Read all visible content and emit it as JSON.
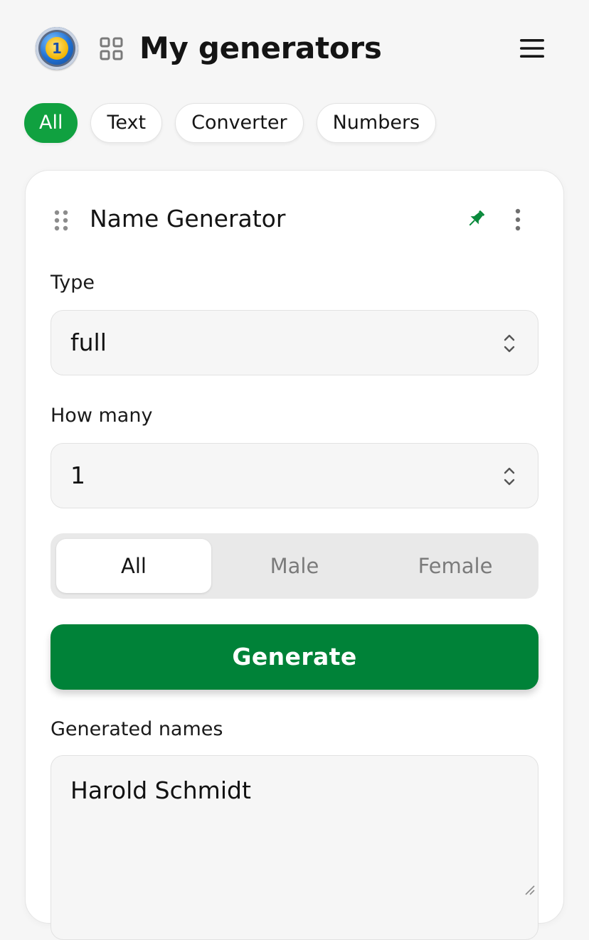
{
  "header": {
    "title": "My generators",
    "logo_text": "1",
    "icons": {
      "logo": "app-logo",
      "apps": "grid-icon",
      "menu": "hamburger-menu-icon"
    }
  },
  "filters": {
    "chips": [
      {
        "label": "All",
        "active": true
      },
      {
        "label": "Text",
        "active": false
      },
      {
        "label": "Converter",
        "active": false
      },
      {
        "label": "Numbers",
        "active": false
      }
    ]
  },
  "card": {
    "title": "Name Generator",
    "icons": {
      "drag": "drag-handle-icon",
      "pin": "pin-icon",
      "more": "more-vertical-icon"
    },
    "type": {
      "label": "Type",
      "value": "full"
    },
    "count": {
      "label": "How many",
      "value": "1"
    },
    "gender": {
      "options": [
        "All",
        "Male",
        "Female"
      ],
      "selected": "All"
    },
    "generate_label": "Generate",
    "output": {
      "label": "Generated names",
      "value": "Harold Schmidt"
    }
  },
  "colors": {
    "accent": "#10a140",
    "primary_button": "#008238",
    "pin": "#0a8a3c",
    "background": "#f6f6f6"
  }
}
